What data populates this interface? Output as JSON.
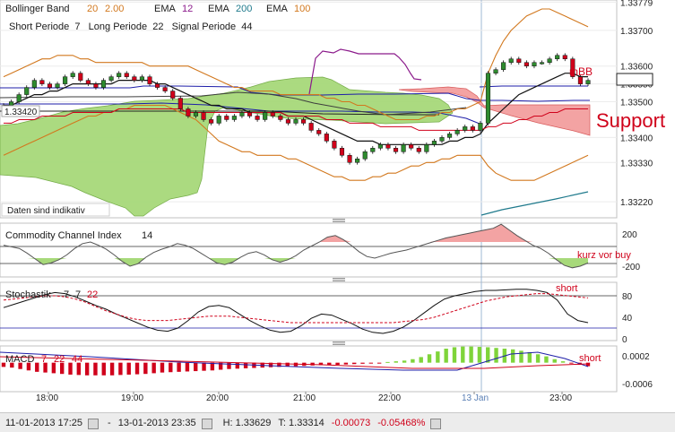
{
  "header": {
    "bb_label": "Bollinger Band",
    "bb_p1": "20",
    "bb_p2": "2.00",
    "ema_a": "EMA",
    "ema_a_val": "12",
    "ema_b": "EMA",
    "ema_b_val": "200",
    "ema_c": "EMA",
    "ema_c_val": "100",
    "ichimoku": "Short Periode  7   Long Periode  22   Signal Periode  44",
    "current_price_tag": "1.33420",
    "watermark": "Daten sind indikativ"
  },
  "annotations": {
    "mbb": "mBB",
    "support": "Support",
    "cci_note": "kurz vor buy",
    "stoch_note": "short",
    "macd_note": "short"
  },
  "panels": {
    "cci_title": "Commodity Channel Index",
    "cci_val": "14",
    "stoch_title": "Stochastik",
    "stoch_p1": "7",
    "stoch_p2": "7",
    "stoch_p3": "22",
    "macd_title": "MACD",
    "macd_p1": "7",
    "macd_p2": "22",
    "macd_p3": "44"
  },
  "status": {
    "from": "11-01-2013 17:25",
    "dash": "-",
    "to": "13-01-2013 23:35",
    "high": "H: 1.33629",
    "low": "T: 1.33314",
    "change": "-0.00073",
    "change_pct": "-0.05468%"
  },
  "colors": {
    "candle_up": "#2e8b2e",
    "candle_down": "#d0021b",
    "bb": "#d2781e",
    "ema12": "#8b1a8b",
    "ema200": "#1f7a8c",
    "ema100": "#d2781e",
    "cloud_green": "#a7d97a",
    "cloud_red": "#f3a3a3",
    "macd_bar_pos": "#7fd43a",
    "macd_bar_neg": "#d0021b",
    "annotation": "#d0021b"
  },
  "chart_data": [
    {
      "type": "candlestick",
      "title": "Bollinger Band 20 2.00 / EMA 12 / EMA 200 / EMA 100",
      "y_ticks": [
        "1.33779",
        "1.33700",
        "1.33600",
        "1.33550",
        "1.33500",
        "1.33400",
        "1.33330",
        "1.33220"
      ],
      "ylim": [
        1.3318,
        1.3378
      ],
      "x_ticks": [
        "18:00",
        "19:00",
        "20:00",
        "21:00",
        "22:00",
        "13 Jan",
        "23:00"
      ],
      "close": [
        1.3349,
        1.335,
        1.3352,
        1.3354,
        1.3356,
        1.3355,
        1.3354,
        1.3355,
        1.3357,
        1.3358,
        1.3356,
        1.3355,
        1.3354,
        1.3356,
        1.3357,
        1.3358,
        1.3357,
        1.3356,
        1.3357,
        1.3355,
        1.3354,
        1.3353,
        1.3351,
        1.3348,
        1.3346,
        1.3347,
        1.3345,
        1.3344,
        1.3346,
        1.3345,
        1.3346,
        1.3347,
        1.3346,
        1.3345,
        1.3347,
        1.3346,
        1.3345,
        1.3344,
        1.3345,
        1.3344,
        1.3342,
        1.3341,
        1.3339,
        1.3337,
        1.3335,
        1.3333,
        1.3334,
        1.3336,
        1.3337,
        1.3338,
        1.3337,
        1.3336,
        1.3338,
        1.3337,
        1.3336,
        1.3338,
        1.3339,
        1.334,
        1.3341,
        1.3342,
        1.3343,
        1.3342,
        1.3344,
        1.3358,
        1.3359,
        1.3361,
        1.3362,
        1.3361,
        1.336,
        1.3361,
        1.3361,
        1.3362,
        1.3363,
        1.3362,
        1.3357,
        1.3355,
        1.3356
      ],
      "ema12": [
        1.3349,
        1.3349,
        1.335,
        1.3351,
        1.3352,
        1.3352,
        1.3353,
        1.3353,
        1.3354,
        1.3355,
        1.3355,
        1.3355,
        1.3355,
        1.3355,
        1.3355,
        1.3356,
        1.3356,
        1.3356,
        1.3356,
        1.3356,
        1.3355,
        1.3355,
        1.3354,
        1.3353,
        1.3352,
        1.3351,
        1.335,
        1.3349,
        1.3349,
        1.3348,
        1.3348,
        1.3348,
        1.3347,
        1.3347,
        1.3347,
        1.3347,
        1.3347,
        1.3346,
        1.3346,
        1.3346,
        1.3345,
        1.3344,
        1.3343,
        1.3342,
        1.3341,
        1.334,
        1.3339,
        1.3339,
        1.3339,
        1.3338,
        1.3338,
        1.3338,
        1.3338,
        1.3338,
        1.3338,
        1.3338,
        1.3338,
        1.3338,
        1.3339,
        1.3339,
        1.334,
        1.334,
        1.3341,
        1.3344,
        1.3346,
        1.3348,
        1.335,
        1.3352,
        1.3353,
        1.3354,
        1.3355,
        1.3356,
        1.3357,
        1.3358,
        1.3358,
        1.3357,
        1.3357
      ],
      "ema100": [
        1.3344,
        1.3344,
        1.3345,
        1.3345,
        1.3345,
        1.3346,
        1.3346,
        1.3346,
        1.3346,
        1.3347,
        1.3347,
        1.3347,
        1.3347,
        1.3347,
        1.3347,
        1.3348,
        1.3348,
        1.3348,
        1.3348,
        1.3348,
        1.3348,
        1.3348,
        1.3348,
        1.3348,
        1.3347,
        1.3347,
        1.3347,
        1.3347,
        1.3347,
        1.3347,
        1.3347,
        1.3347,
        1.3347,
        1.3347,
        1.3347,
        1.3347,
        1.3347,
        1.3346,
        1.3346,
        1.3346,
        1.3346,
        1.3346,
        1.3345,
        1.3345,
        1.3345,
        1.3344,
        1.3344,
        1.3344,
        1.3344,
        1.3343,
        1.3343,
        1.3343,
        1.3343,
        1.3343,
        1.3342,
        1.3342,
        1.3342,
        1.3342,
        1.3342,
        1.3342,
        1.3342,
        1.3342,
        1.3342,
        1.3343,
        1.3343,
        1.3344,
        1.3344,
        1.3345,
        1.3345,
        1.3346,
        1.3346,
        1.3347,
        1.3347,
        1.3348,
        1.3348,
        1.3348,
        1.3348
      ],
      "ema200": [
        1.331,
        1.331,
        1.3311,
        1.3311,
        1.3312,
        1.3313
      ],
      "bb_upper": [
        1.3357,
        1.3358,
        1.3359,
        1.336,
        1.3361,
        1.3362,
        1.3362,
        1.3363,
        1.3363,
        1.3363,
        1.3362,
        1.3362,
        1.3361,
        1.3361,
        1.3361,
        1.3361,
        1.3361,
        1.3361,
        1.3361,
        1.336,
        1.336,
        1.336,
        1.336,
        1.336,
        1.336,
        1.3359,
        1.3358,
        1.3357,
        1.3356,
        1.3355,
        1.3354,
        1.3354,
        1.3353,
        1.3353,
        1.3353,
        1.3353,
        1.3352,
        1.3352,
        1.3352,
        1.3352,
        1.3352,
        1.3352,
        1.3351,
        1.3351,
        1.335,
        1.335,
        1.3349,
        1.3349,
        1.3348,
        1.3347,
        1.3346,
        1.3345,
        1.3345,
        1.3345,
        1.3345,
        1.3346,
        1.3346,
        1.3347,
        1.3347,
        1.3348,
        1.3348,
        1.3349,
        1.335,
        1.3358,
        1.3363,
        1.3367,
        1.337,
        1.3372,
        1.3374,
        1.3375,
        1.3376,
        1.3376,
        1.3375,
        1.3374,
        1.3373,
        1.3372,
        1.3371
      ],
      "bb_lower": [
        1.3335,
        1.3336,
        1.3337,
        1.3338,
        1.3339,
        1.334,
        1.3341,
        1.3342,
        1.3343,
        1.3344,
        1.3345,
        1.3346,
        1.3346,
        1.3347,
        1.3347,
        1.3348,
        1.3348,
        1.3349,
        1.3349,
        1.3349,
        1.3349,
        1.3349,
        1.3348,
        1.3347,
        1.3346,
        1.3345,
        1.3343,
        1.3341,
        1.3339,
        1.3338,
        1.3337,
        1.3336,
        1.3336,
        1.3335,
        1.3335,
        1.3335,
        1.3335,
        1.3334,
        1.3334,
        1.3333,
        1.3332,
        1.3331,
        1.333,
        1.3329,
        1.3329,
        1.3328,
        1.3328,
        1.3328,
        1.3329,
        1.3329,
        1.333,
        1.333,
        1.3331,
        1.3332,
        1.3332,
        1.3333,
        1.3333,
        1.3334,
        1.3334,
        1.3335,
        1.3335,
        1.3335,
        1.3335,
        1.3332,
        1.333,
        1.3329,
        1.3328,
        1.3328,
        1.3328,
        1.3328,
        1.3329,
        1.333,
        1.3331,
        1.3332,
        1.3333,
        1.3334,
        1.3335
      ]
    },
    {
      "type": "line",
      "title": "Commodity Channel Index 14",
      "y_ticks": [
        "200",
        "-200"
      ],
      "ylim": [
        -300,
        300
      ],
      "values": [
        60,
        40,
        20,
        -40,
        -110,
        -180,
        -160,
        -120,
        -60,
        20,
        80,
        100,
        60,
        10,
        -60,
        -140,
        -200,
        -170,
        -90,
        -30,
        10,
        40,
        80,
        60,
        20,
        -40,
        -100,
        -160,
        -180,
        -150,
        -90,
        -40,
        -20,
        -60,
        -120,
        -150,
        -120,
        -70,
        0,
        50,
        100,
        160,
        180,
        130,
        60,
        -20,
        -80,
        -100,
        -70,
        -40,
        -20,
        0,
        30,
        60,
        90,
        120,
        150,
        170,
        190,
        210,
        230,
        250,
        270,
        320,
        250,
        180,
        120,
        60,
        20,
        -40,
        -120,
        -190,
        -220,
        -200,
        -160
      ]
    },
    {
      "type": "line",
      "title": "Stochastik 7 7 22",
      "y_ticks": [
        "80",
        "40",
        "0"
      ],
      "ylim": [
        0,
        100
      ],
      "series": [
        {
          "values": [
            58,
            64,
            70,
            76,
            82,
            86,
            84,
            78,
            70,
            62,
            55,
            46,
            38,
            30,
            22,
            16,
            14,
            20,
            34,
            50,
            60,
            62,
            58,
            46,
            34,
            24,
            16,
            12,
            14,
            24,
            38,
            46,
            44,
            36,
            28,
            18,
            12,
            10,
            14,
            22,
            34,
            48,
            62,
            74,
            80,
            84,
            88,
            90,
            90,
            91,
            92,
            92,
            90,
            86,
            72,
            46,
            34,
            30
          ]
        },
        {
          "values": [
            72,
            74,
            76,
            78,
            80,
            80,
            78,
            74,
            68,
            60,
            52,
            46,
            40,
            36,
            34,
            34,
            34,
            36,
            38,
            40,
            42,
            42,
            42,
            40,
            38,
            36,
            34,
            32,
            30,
            30,
            30,
            30,
            30,
            30,
            30,
            30,
            30,
            30,
            30,
            32,
            34,
            36,
            40,
            46,
            52,
            58,
            64,
            70,
            74,
            78,
            80,
            82,
            84,
            84,
            82,
            80,
            78,
            76
          ]
        }
      ]
    },
    {
      "type": "bar",
      "title": "MACD 7 22 44",
      "y_ticks": [
        "0.0002",
        "-0.0006"
      ],
      "ylim": [
        -0.0008,
        0.0004
      ],
      "values": [
        -0.00012,
        -0.00014,
        -0.00018,
        -0.00022,
        -0.00026,
        -0.00028,
        -0.0003,
        -0.00032,
        -0.00034,
        -0.00035,
        -0.00036,
        -0.00036,
        -0.00036,
        -0.00036,
        -0.00035,
        -0.00034,
        -0.00033,
        -0.00032,
        -0.0003,
        -0.00028,
        -0.00027,
        -0.00026,
        -0.00025,
        -0.00024,
        -0.00023,
        -0.00022,
        -0.0002,
        -0.00018,
        -0.00017,
        -0.00016,
        -0.00015,
        -0.00014,
        -0.00013,
        -0.00012,
        -0.00011,
        -0.0001,
        -9e-05,
        -8e-05,
        -7e-05,
        -7e-05,
        -6e-05,
        -5e-05,
        -4e-05,
        -3e-05,
        -2e-05,
        -1e-05,
        2e-05,
        4e-05,
        6e-05,
        0.0001,
        0.00016,
        0.00024,
        0.00032,
        0.0004,
        0.00044,
        0.00046,
        0.00046,
        0.00045,
        0.00044,
        0.00042,
        0.0004,
        0.00038,
        0.00034,
        0.0003,
        0.00024,
        0.00018,
        0.0001,
        4e-05,
        -2e-05,
        -6e-05,
        -0.0001
      ]
    }
  ]
}
